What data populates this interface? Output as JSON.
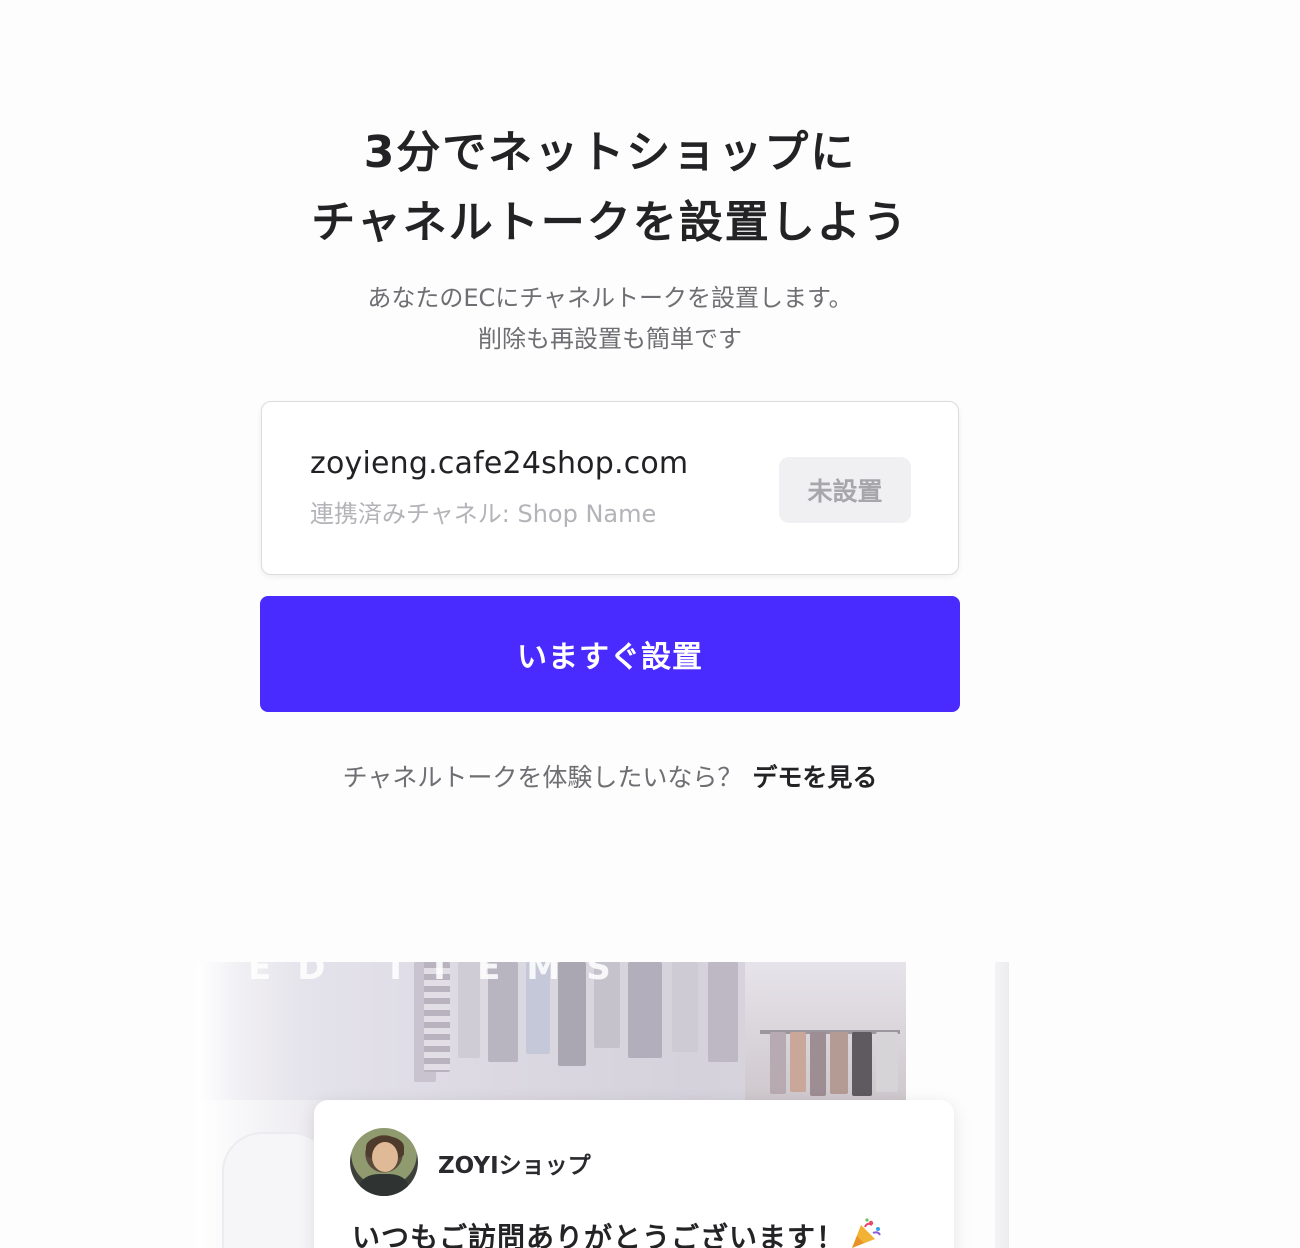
{
  "hero": {
    "title_line1": "3分でネットショップに",
    "title_line2": "チャネルトークを設置しよう",
    "subtitle_line1": "あなたのECにチャネルトークを設置します。",
    "subtitle_line2": "削除も再設置も簡単です"
  },
  "shop": {
    "domain": "zoyieng.cafe24shop.com",
    "channel": "連携済みチャネル: Shop Name",
    "status": "未設置"
  },
  "install": {
    "button_label": "いますぐ設置"
  },
  "demo": {
    "prompt": "チャネルトークを体験したいなら？",
    "link_label": "デモを見る"
  },
  "preview": {
    "banner_text": "ED ITEMS",
    "chat": {
      "shop_name": "ZOYIショップ",
      "message": "いつもご訪問ありがとうございます！",
      "emoji_icon": "party-popper-icon"
    }
  },
  "colors": {
    "accent": "#4a2bff",
    "badge_bg": "#f0f0f2",
    "badge_text": "#a6a6ab"
  }
}
